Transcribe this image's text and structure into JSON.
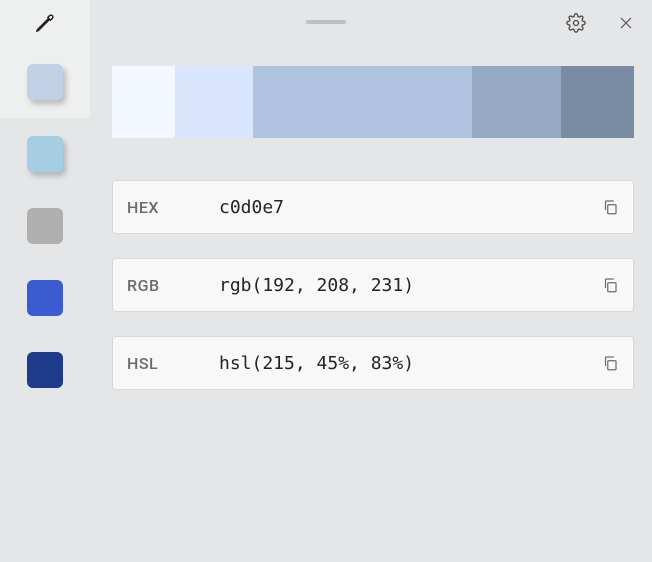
{
  "sidebar": {
    "swatches": [
      {
        "color": "#c0d0e7",
        "active": true,
        "shadow": true
      },
      {
        "color": "#a6cee3",
        "active": false,
        "shadow": true
      },
      {
        "color": "#b0b0b0",
        "active": false,
        "shadow": false
      },
      {
        "color": "#3b5bd1",
        "active": false,
        "shadow": false
      },
      {
        "color": "#1e3a8a",
        "active": false,
        "shadow": false
      }
    ]
  },
  "shades": [
    {
      "color": "#f3f7ff",
      "flex": 0.12
    },
    {
      "color": "#d9e5fc",
      "flex": 0.15
    },
    {
      "color": "#afc3e0",
      "flex": 0.42
    },
    {
      "color": "#95a9c3",
      "flex": 0.17
    },
    {
      "color": "#7a8ca3",
      "flex": 0.14
    }
  ],
  "values": {
    "hex": {
      "label": "HEX",
      "value": "c0d0e7"
    },
    "rgb": {
      "label": "RGB",
      "value": "rgb(192, 208, 231)"
    },
    "hsl": {
      "label": "HSL",
      "value": "hsl(215, 45%, 83%)"
    }
  }
}
